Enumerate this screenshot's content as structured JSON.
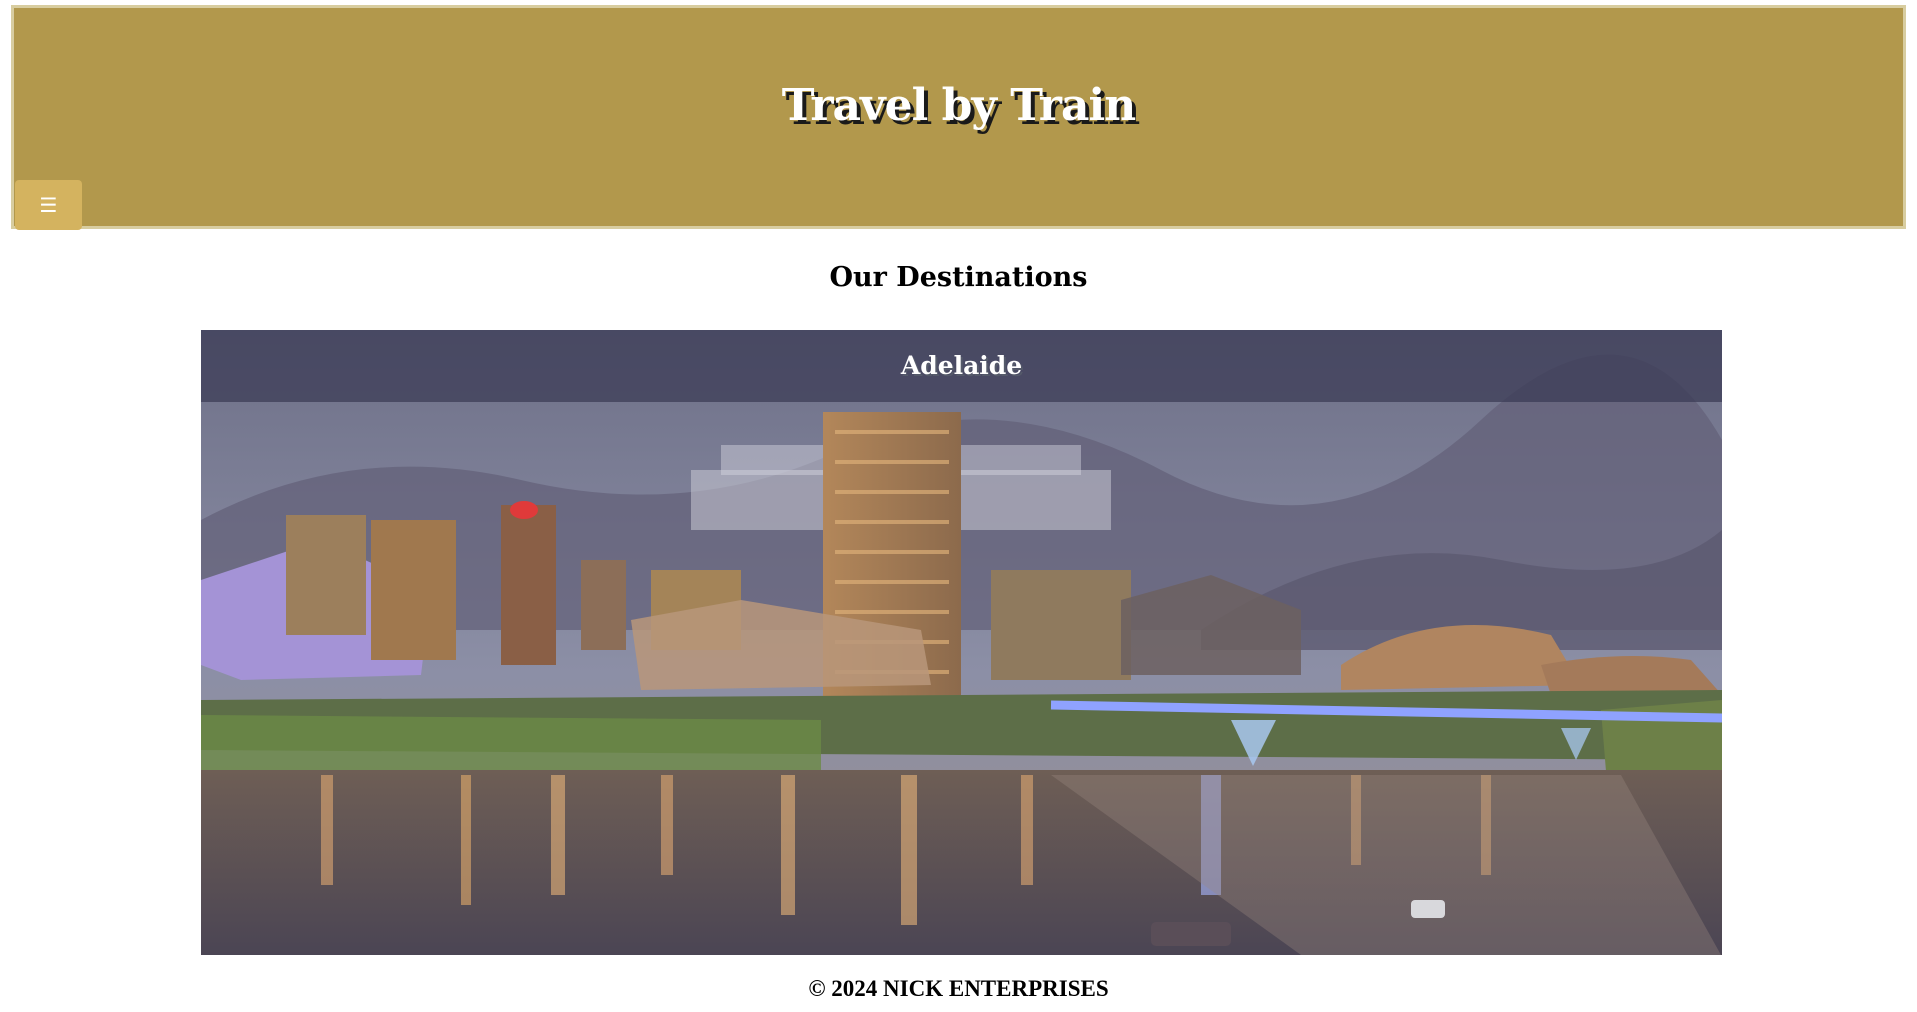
{
  "header": {
    "title": "Travel by Train",
    "menu_icon": "☰"
  },
  "main": {
    "section_title": "Our Destinations",
    "destinations": [
      {
        "caption": "Adelaide",
        "image": "adelaide-city-night-skyline"
      }
    ]
  },
  "footer": {
    "text": "© 2024 NICK ENTERPRISES"
  },
  "colors": {
    "header_bg": "#b2984c",
    "menu_button_bg": "#d4b35f",
    "caption_bg": "#3a3a54"
  }
}
